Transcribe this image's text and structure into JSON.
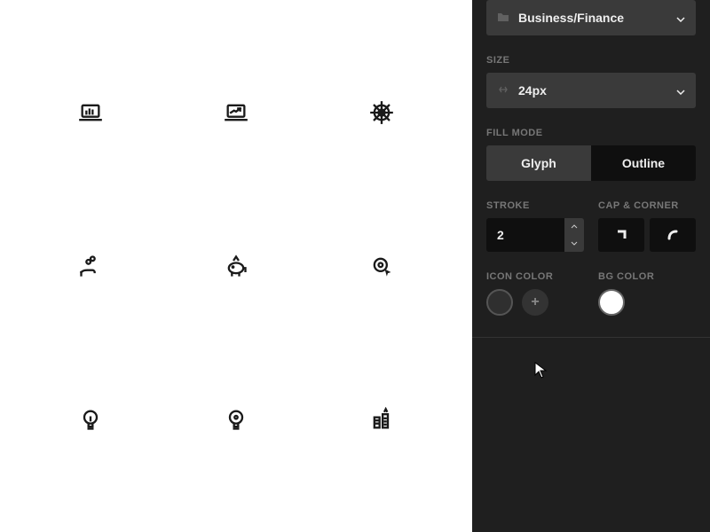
{
  "category": {
    "label": "Business/Finance"
  },
  "size": {
    "section": "SIZE",
    "value": "24px"
  },
  "fillMode": {
    "section": "FILL MODE",
    "options": [
      "Glyph",
      "Outline"
    ],
    "active": "Glyph"
  },
  "stroke": {
    "section": "STROKE",
    "value": "2"
  },
  "capCorner": {
    "section": "CAP & CORNER"
  },
  "iconColor": {
    "section": "ICON COLOR",
    "value": "#2f2f2f"
  },
  "bgColor": {
    "section": "BG COLOR",
    "value": "#ffffff"
  },
  "icons": [
    "laptop-chart",
    "laptop-growth",
    "spider-web",
    "hand-coins",
    "piggy-bank",
    "target-cursor",
    "lightbulb",
    "idea-bulb",
    "city-buildings"
  ]
}
